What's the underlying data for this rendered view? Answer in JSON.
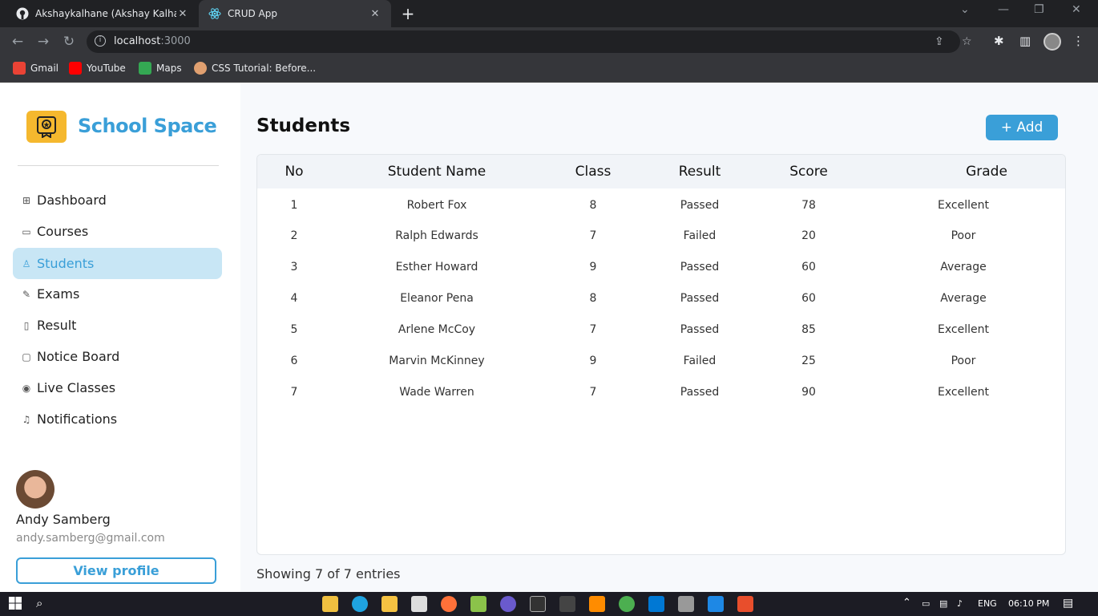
{
  "browser": {
    "tabs": [
      {
        "title": "Akshaykalhane (Akshay Kalhane)",
        "active": false
      },
      {
        "title": "CRUD App",
        "active": true
      }
    ],
    "url_host": "localhost",
    "url_port": ":3000",
    "bookmarks": [
      {
        "label": "Gmail",
        "color": "#ea4335"
      },
      {
        "label": "YouTube",
        "color": "#ff0000"
      },
      {
        "label": "Maps",
        "color": "#34a853"
      },
      {
        "label": "CSS Tutorial: Before...",
        "color": "#e0a070"
      }
    ]
  },
  "sidebar": {
    "brand": "School Space",
    "items": [
      {
        "label": "Dashboard",
        "icon": "grid-icon",
        "active": false
      },
      {
        "label": "Courses",
        "icon": "monitor-icon",
        "active": false
      },
      {
        "label": "Students",
        "icon": "student-icon",
        "active": true
      },
      {
        "label": "Exams",
        "icon": "exam-icon",
        "active": false
      },
      {
        "label": "Result",
        "icon": "file-icon",
        "active": false
      },
      {
        "label": "Notice Board",
        "icon": "board-icon",
        "active": false
      },
      {
        "label": "Live Classes",
        "icon": "broadcast-icon",
        "active": false
      },
      {
        "label": "Notifications",
        "icon": "bell-icon",
        "active": false
      }
    ],
    "profile": {
      "name": "Andy Samberg",
      "email": "andy.samberg@gmail.com",
      "button": "View profile"
    }
  },
  "main": {
    "title": "Students",
    "add_button": "+ Add",
    "columns": [
      "No",
      "Student Name",
      "Class",
      "Result",
      "Score",
      "Grade"
    ],
    "rows": [
      [
        "1",
        "Robert Fox",
        "8",
        "Passed",
        "78",
        "Excellent"
      ],
      [
        "2",
        "Ralph Edwards",
        "7",
        "Failed",
        "20",
        "Poor"
      ],
      [
        "3",
        "Esther Howard",
        "9",
        "Passed",
        "60",
        "Average"
      ],
      [
        "4",
        "Eleanor Pena",
        "8",
        "Passed",
        "60",
        "Average"
      ],
      [
        "5",
        "Arlene McCoy",
        "7",
        "Passed",
        "85",
        "Excellent"
      ],
      [
        "6",
        "Marvin McKinney",
        "9",
        "Failed",
        "25",
        "Poor"
      ],
      [
        "7",
        "Wade Warren",
        "7",
        "Passed",
        "90",
        "Excellent"
      ]
    ],
    "footer": "Showing 7 of 7 entries"
  },
  "taskbar": {
    "lang": "ENG",
    "time": "06:10 PM"
  },
  "colors": {
    "accent": "#3a9fd8",
    "active_bg": "#c8e6f5",
    "logo_bg": "#f5b82e"
  }
}
